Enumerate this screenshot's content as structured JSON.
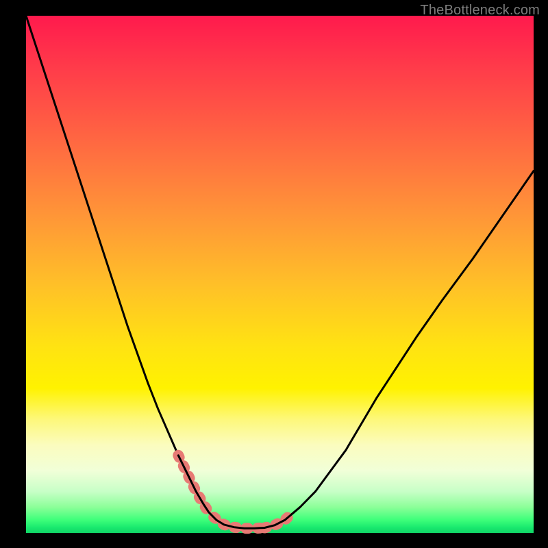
{
  "watermark": "TheBottleneck.com",
  "chart_data": {
    "type": "line",
    "title": "",
    "xlabel": "",
    "ylabel": "",
    "xlim": [
      0,
      100
    ],
    "ylim": [
      0,
      100
    ],
    "series": [
      {
        "name": "black-curve",
        "x": [
          0,
          2,
          4,
          6,
          8,
          10,
          12,
          14,
          16,
          18,
          20,
          22,
          24,
          26,
          28,
          30,
          32,
          33.5,
          35,
          36,
          37.5,
          39,
          41,
          43,
          45,
          47,
          49,
          51,
          54,
          57,
          60,
          63,
          66,
          69,
          73,
          77,
          82,
          88,
          94,
          100
        ],
        "y": [
          100,
          94,
          88,
          82,
          76,
          70,
          64,
          58,
          52,
          46,
          40,
          34.5,
          29,
          24,
          19.5,
          15,
          11,
          8,
          5.5,
          4,
          2.5,
          1.6,
          1.1,
          0.9,
          0.9,
          1.0,
          1.5,
          2.5,
          5,
          8,
          12,
          16,
          21,
          26,
          32,
          38,
          45,
          53,
          61.5,
          70
        ]
      }
    ],
    "highlights": [
      {
        "name": "highlight-left",
        "x_start": 30,
        "x_end": 36,
        "color": "#e77a74"
      },
      {
        "name": "highlight-right",
        "x_start": 47,
        "x_end": 52,
        "color": "#e77a74"
      },
      {
        "name": "highlight-bottom",
        "x_start": 37,
        "x_end": 47,
        "color": "#e77a74"
      }
    ]
  }
}
